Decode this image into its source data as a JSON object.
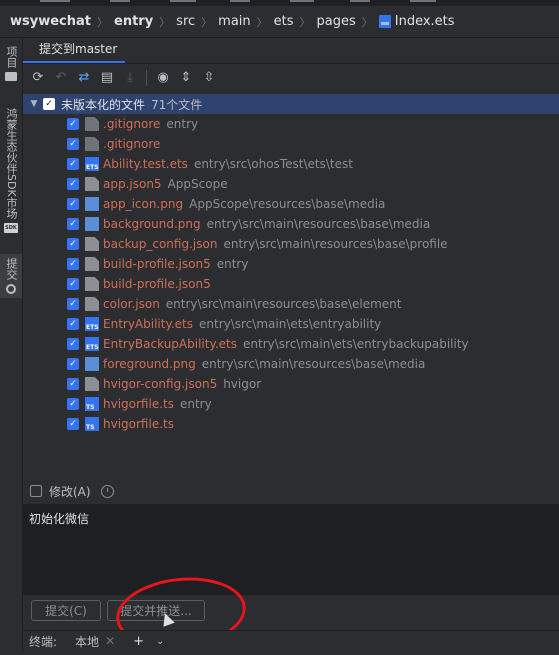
{
  "breadcrumb": {
    "items": [
      "wsywechat",
      "entry",
      "src",
      "main",
      "ets",
      "pages",
      "Index.ets"
    ]
  },
  "left_stripe": {
    "project_label": "项目",
    "ecosystem_label": "鸿蒙生态伙伴SDK市场",
    "sdk_badge": "SDK",
    "commit_label": "提交"
  },
  "panel": {
    "tab_label": "提交到master"
  },
  "toolbar": {
    "icons": [
      "refresh-icon",
      "rollback-icon",
      "diff-icon",
      "shelve-icon",
      "download-icon",
      "eye-icon",
      "expand-all-icon",
      "collapse-all-icon"
    ]
  },
  "changes": {
    "group_label": "未版本化的文件",
    "group_count": "71个文件",
    "files": [
      {
        "name": ".gitignore",
        "path": "entry",
        "icon": "file"
      },
      {
        "name": ".gitignore",
        "path": "",
        "icon": "file"
      },
      {
        "name": "Ability.test.ets",
        "path": "entry\\src\\ohosTest\\ets\\test",
        "icon": "ets"
      },
      {
        "name": "app.json5",
        "path": "AppScope",
        "icon": "json"
      },
      {
        "name": "app_icon.png",
        "path": "AppScope\\resources\\base\\media",
        "icon": "img"
      },
      {
        "name": "background.png",
        "path": "entry\\src\\main\\resources\\base\\media",
        "icon": "img"
      },
      {
        "name": "backup_config.json",
        "path": "entry\\src\\main\\resources\\base\\profile",
        "icon": "json"
      },
      {
        "name": "build-profile.json5",
        "path": "entry",
        "icon": "json"
      },
      {
        "name": "build-profile.json5",
        "path": "",
        "icon": "json"
      },
      {
        "name": "color.json",
        "path": "entry\\src\\main\\resources\\base\\element",
        "icon": "json"
      },
      {
        "name": "EntryAbility.ets",
        "path": "entry\\src\\main\\ets\\entryability",
        "icon": "ets"
      },
      {
        "name": "EntryBackupAbility.ets",
        "path": "entry\\src\\main\\ets\\entrybackupability",
        "icon": "ets"
      },
      {
        "name": "foreground.png",
        "path": "entry\\src\\main\\resources\\base\\media",
        "icon": "img"
      },
      {
        "name": "hvigor-config.json5",
        "path": "hvigor",
        "icon": "json"
      },
      {
        "name": "hvigorfile.ts",
        "path": "entry",
        "icon": "ts"
      },
      {
        "name": "hvigorfile.ts",
        "path": "",
        "icon": "ts"
      }
    ]
  },
  "amend": {
    "label": "修改(A)",
    "checked": false
  },
  "commit_message": {
    "value": "初始化微信"
  },
  "buttons": {
    "commit": "提交(C)",
    "commit_push": "提交并推送..."
  },
  "terminal": {
    "label": "终端:",
    "tab": "本地"
  }
}
